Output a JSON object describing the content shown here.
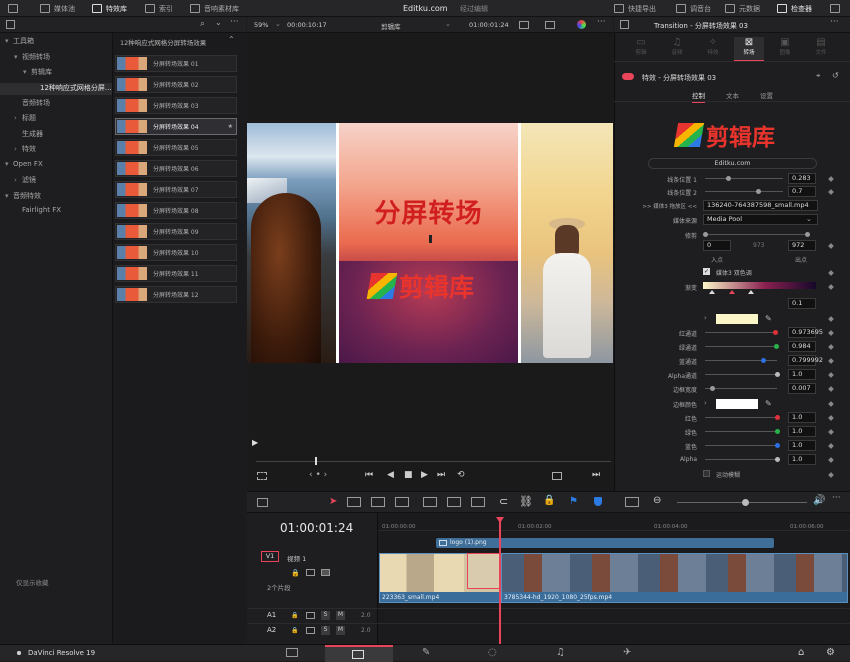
{
  "topbar": {
    "media_pool": "媒体池",
    "effects": "特效库",
    "index": "索引",
    "sound_library": "音响素材库",
    "site": "Editku.com",
    "edit_index": "经过编辑",
    "quick_export": "快捷导出",
    "mixer": "调音台",
    "metadata": "元数据",
    "inspector": "检查器"
  },
  "left_panel": {
    "tree": [
      {
        "label": "工具箱",
        "indent": 0,
        "arrow": "▾"
      },
      {
        "label": "视频转场",
        "indent": 1,
        "arrow": "▾"
      },
      {
        "label": "剪辑库",
        "indent": 2,
        "arrow": "▾"
      },
      {
        "label": "12种响应式网格分屏...",
        "indent": 3,
        "arrow": ""
      },
      {
        "label": "音频转场",
        "indent": 1,
        "arrow": ""
      },
      {
        "label": "标题",
        "indent": 1,
        "arrow": "›"
      },
      {
        "label": "生成器",
        "indent": 1,
        "arrow": ""
      },
      {
        "label": "特效",
        "indent": 1,
        "arrow": "›"
      },
      {
        "label": "Open FX",
        "indent": 0,
        "arrow": "▾"
      },
      {
        "label": "滤镜",
        "indent": 1,
        "arrow": "›"
      },
      {
        "label": "音频特效",
        "indent": 0,
        "arrow": "▾"
      },
      {
        "label": "Fairlight FX",
        "indent": 1,
        "arrow": ""
      }
    ],
    "favorites": "仅显示收藏",
    "list_header": "12种响应式网格分屏转场效果",
    "effects": [
      "分屏转场效果 01",
      "分屏转场效果 02",
      "分屏转场效果 03",
      "分屏转场效果 04",
      "分屏转场效果 05",
      "分屏转场效果 06",
      "分屏转场效果 07",
      "分屏转场效果 08",
      "分屏转场效果 09",
      "分屏转场效果 10",
      "分屏转场效果 11",
      "分屏转场效果 12"
    ]
  },
  "viewer": {
    "zoom": "59%",
    "timecode_left": "00:00:10:17",
    "clip_name": "剪辑库",
    "timecode_right": "01:00:01:24",
    "title_text": "分屏转场",
    "logo_text": "剪辑库"
  },
  "inspector": {
    "header": "Transition - 分屏转场效果 03",
    "tabs": [
      "剪辑",
      "音频",
      "特效",
      "转场",
      "图像",
      "文件"
    ],
    "active_tab": "转场",
    "effect_name": "特效 - 分屏转场效果 03",
    "subtabs": [
      "控制",
      "文本",
      "设置"
    ],
    "logo": "剪辑库",
    "site": "Editku.com",
    "line_pos1_label": "线条位置 1",
    "line_pos1": "0.283",
    "line_pos1_fraction": 0.283,
    "line_pos2_label": "线条位置 2",
    "line_pos2": "0.7",
    "line_pos2_fraction": 0.7,
    "media3_label": ">> 媒体3 拖放区 <<",
    "media3_value": "136240-764387598_small.mp4",
    "source_label": "媒体来源",
    "source_value": "Media Pool",
    "trim_label": "修剪",
    "trim_in": "0",
    "trim_mid": "973",
    "trim_out": "972",
    "in_label": "入点",
    "out_label": "出点",
    "duotone_label": "媒体3 双色调",
    "gradient_label": "渐变",
    "gradient_val": "0.1",
    "red_label": "红通道",
    "red": "0.973695",
    "red_fraction": 0.973695,
    "green_label": "绿通道",
    "green": "0.984",
    "green_fraction": 0.984,
    "blue_label": "蓝通道",
    "blue": "0.799992",
    "blue_fraction": 0.799992,
    "alpha_ch_label": "Alpha通道",
    "alpha_ch": "1.0",
    "alpha_ch_fraction": 1.0,
    "border_w_label": "边框宽度",
    "border_w": "0.007",
    "border_w_fraction": 0.007,
    "border_c_label": "边框颜色",
    "r_label": "红色",
    "r": "1.0",
    "g_label": "绿色",
    "g": "1.0",
    "b_label": "蓝色",
    "b": "1.0",
    "a_label": "Alpha",
    "a": "1.0",
    "motion_blur": "运动模糊",
    "colors": {
      "accent": "#e8455a",
      "swatch_light": "#fbf6c8",
      "swatch_white": "#ffffff"
    }
  },
  "timeline": {
    "timecode": "01:00:01:24",
    "ruler": [
      "01:00:00:00",
      "01:00:02:00",
      "01:00:04:00",
      "01:00:06:00"
    ],
    "v1": "V1",
    "v1_name": "视频 1",
    "v1_clips": "2个片段",
    "a1": "A1",
    "a2": "A2",
    "s": "S",
    "m": "M",
    "audio_level": "2.0",
    "title_clip": "logo (1).png",
    "clip1": "223363_small.mp4",
    "clip2": "3785344-hd_1920_1080_25fps.mp4"
  },
  "bottombar": {
    "app": "DaVinci Resolve 19"
  }
}
